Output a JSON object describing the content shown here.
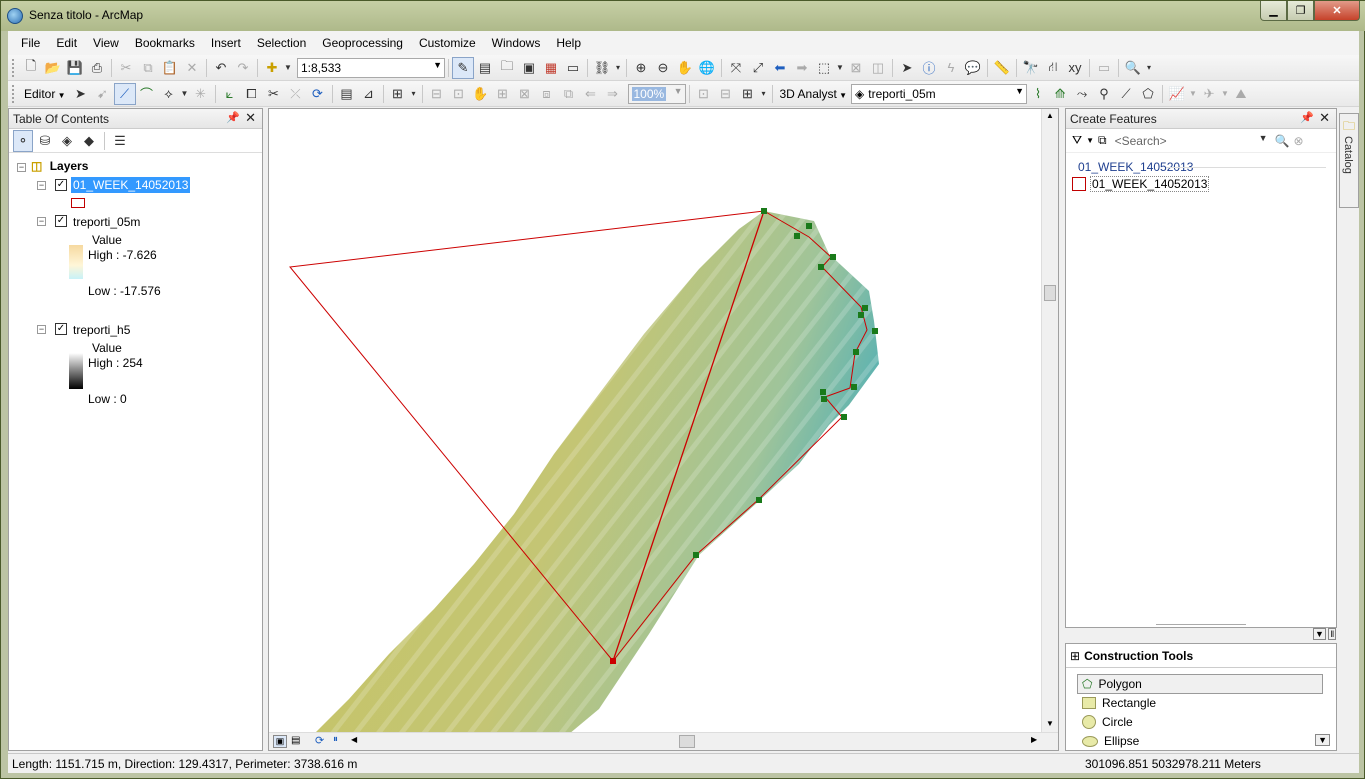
{
  "window": {
    "title": "Senza titolo - ArcMap",
    "controls": [
      "minimize",
      "maximize",
      "close"
    ]
  },
  "menu": [
    "File",
    "Edit",
    "View",
    "Bookmarks",
    "Insert",
    "Selection",
    "Geoprocessing",
    "Customize",
    "Windows",
    "Help"
  ],
  "toolbar_standard": {
    "scale": "1:8,533"
  },
  "toolbar_editor": {
    "editor_label": "Editor",
    "zoom_percent": "100%",
    "analyst_label": "3D Analyst",
    "analyst_layer": "treporti_05m"
  },
  "toc": {
    "title": "Table Of Contents",
    "root": "Layers",
    "layers": [
      {
        "name": "01_WEEK_14052013",
        "checked": true,
        "selected": true
      },
      {
        "name": "treporti_05m",
        "checked": true,
        "legend_title": "Value",
        "high": "High : -7.626",
        "low": "Low : -17.576"
      },
      {
        "name": "treporti_h5",
        "checked": true,
        "legend_title": "Value",
        "high": "High : 254",
        "low": "Low : 0"
      }
    ]
  },
  "create_features": {
    "title": "Create Features",
    "search_placeholder": "<Search>",
    "group": "01_WEEK_14052013",
    "template": "01_WEEK_14052013"
  },
  "construction_tools": {
    "title": "Construction Tools",
    "tools": [
      "Polygon",
      "Rectangle",
      "Circle",
      "Ellipse"
    ],
    "selected": "Polygon"
  },
  "catalog_tab": "Catalog",
  "status": {
    "measurement": "Length: 1151.715 m, Direction: 129.4317, Perimeter: 3738.616 m",
    "coordinates": "301096.851  5032978.211 Meters"
  },
  "colors": {
    "selection": "#3399ff",
    "sketch_line": "#cc0000",
    "vertex": "#1a7a1a",
    "raster_high": "#c8c46a",
    "raster_low": "#5fb3b0"
  }
}
